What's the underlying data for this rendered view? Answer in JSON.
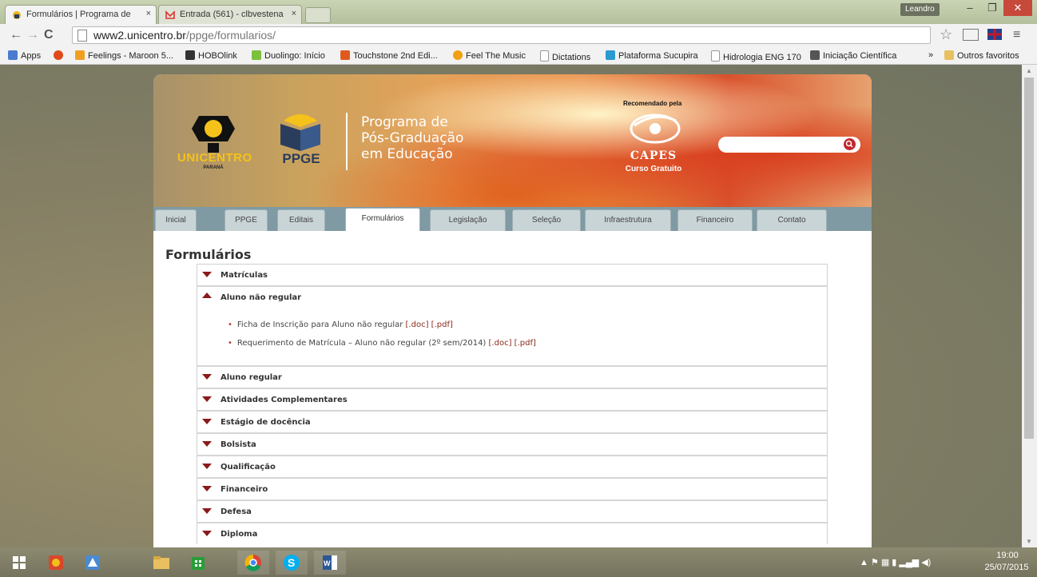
{
  "browser": {
    "tabs": [
      {
        "title": "Formulários | Programa de",
        "close": "×"
      },
      {
        "title": "Entrada (561) - clbvestena",
        "close": "×"
      }
    ],
    "user": "Leandro",
    "window_controls": {
      "min": "–",
      "max": "❐",
      "close": "✕"
    },
    "nav": {
      "back": "←",
      "forward": "→",
      "reload": "C"
    },
    "url_host": "www2.unicentro.br",
    "url_path": "/ppge/formularios/",
    "bookmarks": [
      {
        "label": "Apps",
        "color": "#4a7bd0"
      },
      {
        "label": "",
        "color": "#e04a1a"
      },
      {
        "label": "Feelings - Maroon 5...",
        "color": "#f0a020"
      },
      {
        "label": "HOBOlink",
        "color": "#333333"
      },
      {
        "label": "Duolingo: Início",
        "color": "#7ac13c"
      },
      {
        "label": "Touchstone 2nd Edi...",
        "color": "#e05a20"
      },
      {
        "label": "Feel The Music",
        "color": "#f0a010"
      },
      {
        "label": "Dictations",
        "color": "#dddddd"
      },
      {
        "label": "Plataforma Sucupira",
        "color": "#2a9ad0"
      },
      {
        "label": "Hidrologia ENG 170",
        "color": "#dddddd"
      },
      {
        "label": "Iniciação Científica",
        "color": "#555555"
      }
    ],
    "bookmarks_overflow": "»",
    "other_bookmarks": "Outros favoritos"
  },
  "site": {
    "logo_text": "UNICENTRO",
    "logo_sub": "PARANÁ",
    "ppge": "PPGE",
    "program_title": [
      "Programa de",
      "Pós-Graduação",
      "em Educação"
    ],
    "capes_recommended": "Recomendado pela",
    "capes": "CAPES",
    "capes_sub": "Curso Gratuito",
    "search_placeholder": "",
    "nav_tabs": [
      "Inicial",
      "PPGE",
      "Editais",
      "Formulários",
      "Legislação",
      "Seleção",
      "Infraestrutura",
      "Financeiro",
      "Contato"
    ],
    "active_tab": "Formulários",
    "heading": "Formulários",
    "sections": [
      {
        "label": "Matrículas",
        "open": false
      },
      {
        "label": "Aluno não regular",
        "open": true,
        "docs": [
          {
            "text": "Ficha de Inscrição para Aluno não regular",
            "links": [
              "[.doc]",
              "[.pdf]"
            ]
          },
          {
            "text": "Requerimento de Matrícula – Aluno não regular (2º sem/2014)",
            "links": [
              "[.doc]",
              "[.pdf]"
            ]
          }
        ]
      },
      {
        "label": "Aluno regular",
        "open": false
      },
      {
        "label": "Atividades Complementares",
        "open": false
      },
      {
        "label": "Estágio de docência",
        "open": false
      },
      {
        "label": "Bolsista",
        "open": false
      },
      {
        "label": "Qualificação",
        "open": false
      },
      {
        "label": "Financeiro",
        "open": false
      },
      {
        "label": "Defesa",
        "open": false
      },
      {
        "label": "Diploma",
        "open": false
      }
    ]
  },
  "taskbar": {
    "clock_time": "19:00",
    "clock_date": "25/07/2015"
  }
}
